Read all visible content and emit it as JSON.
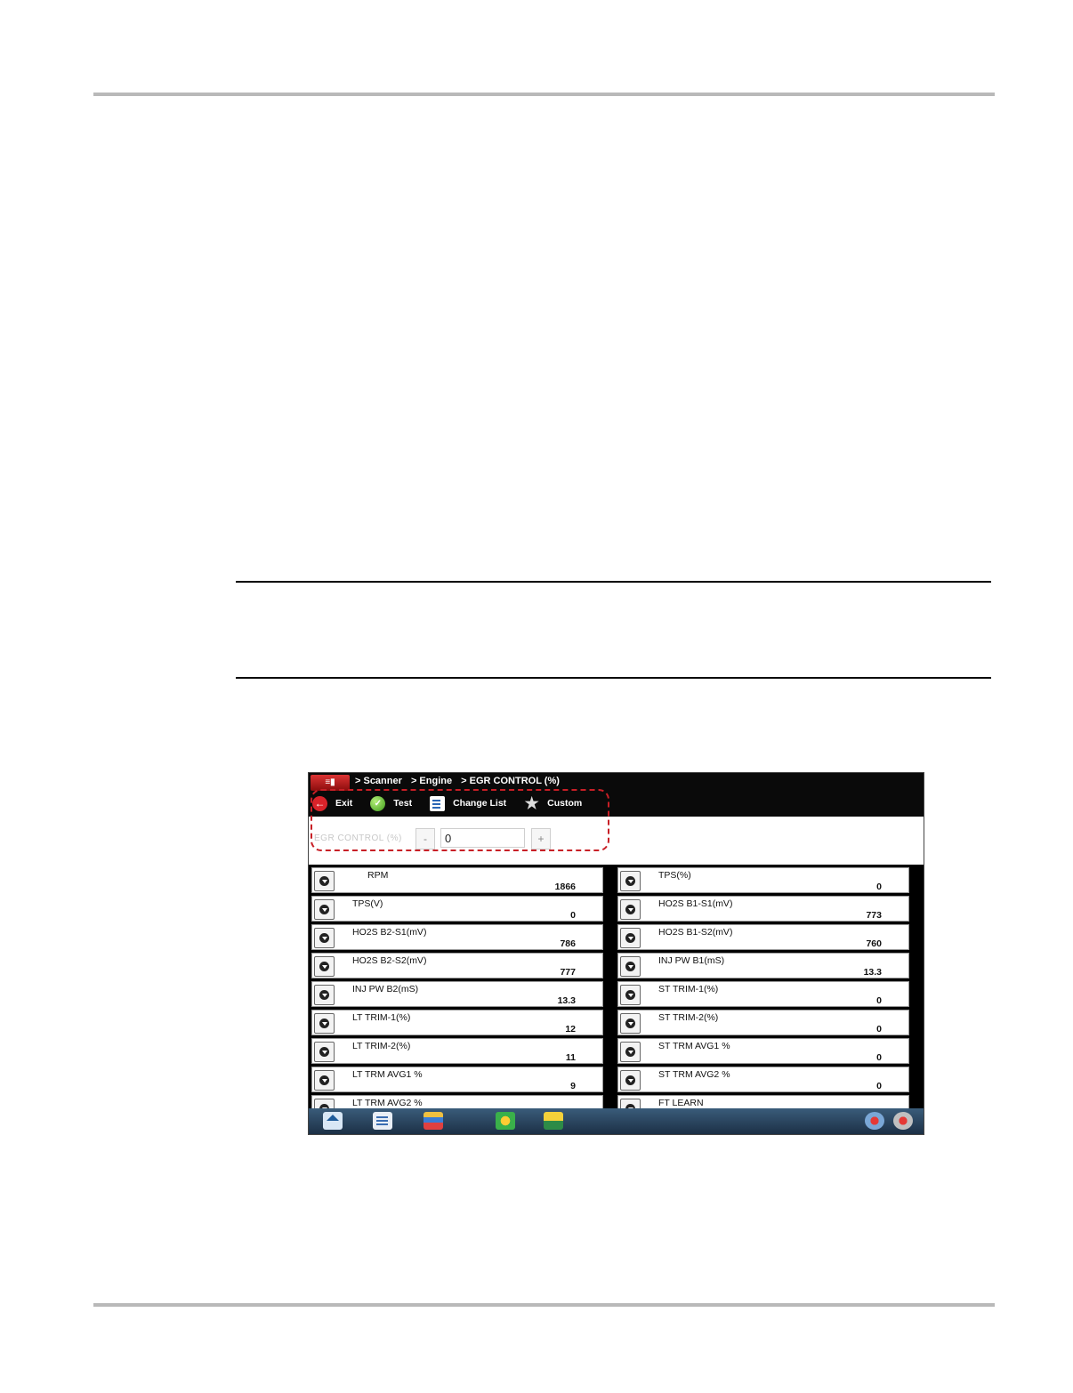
{
  "breadcrumb": [
    "> Scanner",
    "> Engine",
    "> EGR CONTROL (%)"
  ],
  "toolbar": {
    "exit_label": "Exit",
    "test_label": "Test",
    "change_list_label": "Change List",
    "custom_label": "Custom"
  },
  "control": {
    "label": "EGR CONTROL (%)",
    "minus": "-",
    "plus": "+",
    "value": "0"
  },
  "pids": [
    {
      "name": "RPM",
      "value": "1866"
    },
    {
      "name": "TPS(%)",
      "value": "0"
    },
    {
      "name": "TPS(V)",
      "value": "0"
    },
    {
      "name": "HO2S B1-S1(mV)",
      "value": "773"
    },
    {
      "name": "HO2S B2-S1(mV)",
      "value": "786"
    },
    {
      "name": "HO2S B1-S2(mV)",
      "value": "760"
    },
    {
      "name": "HO2S B2-S2(mV)",
      "value": "777"
    },
    {
      "name": "INJ PW B1(mS)",
      "value": "13.3"
    },
    {
      "name": "INJ PW B2(mS)",
      "value": "13.3"
    },
    {
      "name": "ST TRIM-1(%)",
      "value": "0"
    },
    {
      "name": "LT TRIM-1(%)",
      "value": "12"
    },
    {
      "name": "ST TRIM-2(%)",
      "value": "0"
    },
    {
      "name": "LT TRIM-2(%)",
      "value": "11"
    },
    {
      "name": "ST TRM AVG1 %",
      "value": "0"
    },
    {
      "name": "LT TRM AVG1 %",
      "value": "9"
    },
    {
      "name": "ST TRM AVG2 %",
      "value": "0"
    },
    {
      "name": "LT TRM AVG2 %",
      "value": ""
    },
    {
      "name": "FT LEARN",
      "value": ""
    }
  ],
  "colors": {
    "highlight_dash": "#c81f26",
    "titlebar": "#0a0a0a"
  },
  "icons": [
    "home-icon",
    "data-list-icon",
    "tools-icon",
    "shop-icon",
    "data-save-icon",
    "connection-icon",
    "settings-icon"
  ]
}
